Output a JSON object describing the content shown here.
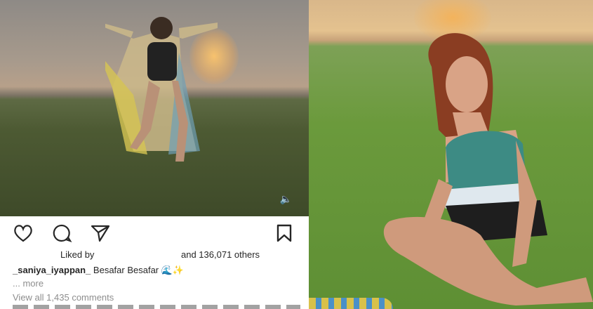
{
  "post": {
    "liked_by_prefix": "Liked by",
    "likes_suffix": "and 136,071 others",
    "username": "_saniya_iyappan_",
    "caption": "Besafar Besafar 🌊✨",
    "more_label": "... more",
    "comments_link": "View all 1,435 comments"
  },
  "icons": {
    "like": "heart-icon",
    "comment": "comment-icon",
    "share": "send-icon",
    "save": "bookmark-icon",
    "volume": "volume-icon"
  },
  "colors": {
    "text": "#262626",
    "muted": "#8e8e8e",
    "background": "#ffffff"
  }
}
